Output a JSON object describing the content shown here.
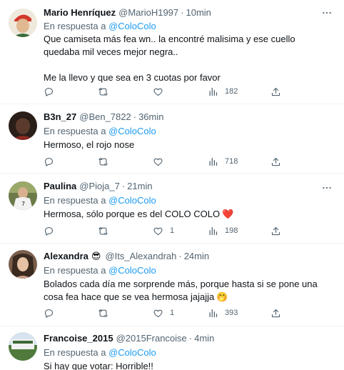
{
  "reply_prefix": "En respuesta a",
  "tweets": [
    {
      "name": "Mario Henríquez",
      "handle": "@MarioH1997",
      "time": "10min",
      "reply_to": "@ColoColo",
      "text": "Que camiseta más fea wn.. la encontré malisima y ese cuello quedaba mil veces mejor negra..\n\nMe la llevo y que sea en 3 cuotas por favor",
      "likes": "",
      "views": "182",
      "avatar_color": "#d2382b"
    },
    {
      "name": "B3n_27",
      "handle": "@Ben_7822",
      "time": "36min",
      "reply_to": "@ColoColo",
      "text": "Hermoso, el rojo nose",
      "likes": "",
      "views": "718",
      "avatar_color": "#3b2a22"
    },
    {
      "name": "Paulina",
      "handle": "@Pioja_7",
      "time": "21min",
      "reply_to": "@ColoColo",
      "text": "Hermosa, sólo porque es del COLO COLO",
      "text_emoji": "❤️",
      "likes": "1",
      "views": "198",
      "avatar_color": "#5c6b3a"
    },
    {
      "name": "Alexandra",
      "name_emoji": "😎",
      "handle": "@Its_Alexandrah",
      "time": "24min",
      "reply_to": "@ColoColo",
      "text": "Bolados cada día me sorprende más, porque hasta si se pone una cosa fea hace que se vea hermosa jajajja",
      "text_emoji": "🤭",
      "likes": "1",
      "views": "393",
      "avatar_color": "#8a6a55"
    },
    {
      "name": "Francoise_2015",
      "handle": "@2015Francoise",
      "time": "4min",
      "reply_to": "@ColoColo",
      "text": "Si hay que votar: Horrible!!",
      "avatar_color": "#4f7a3c"
    }
  ]
}
